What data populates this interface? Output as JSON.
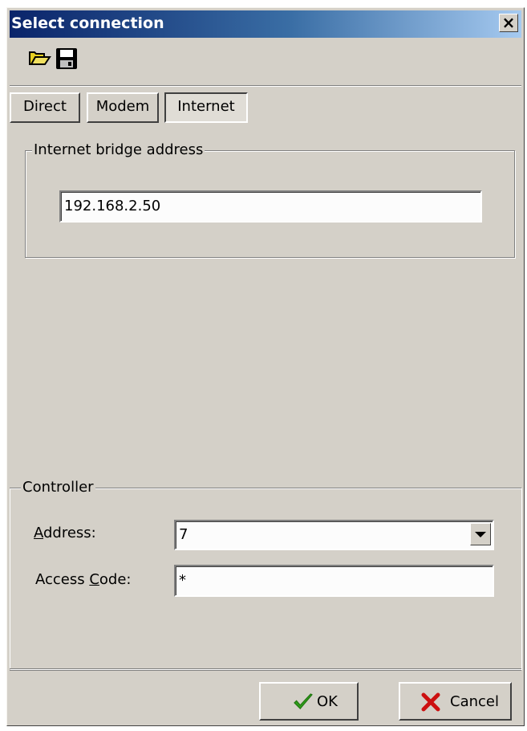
{
  "window": {
    "title": "Select connection",
    "close_glyph": "×"
  },
  "toolbar": {
    "open_icon": "open-folder-icon",
    "save_icon": "floppy-disk-icon"
  },
  "tabs": [
    {
      "label": "Direct"
    },
    {
      "label": "Modem"
    },
    {
      "label": "Internet"
    }
  ],
  "active_tab": "Internet",
  "internet": {
    "group_label": "Internet bridge address",
    "address_value": "192.168.2.50"
  },
  "controller": {
    "group_label": "Controller",
    "address_label_prefix": "A",
    "address_label_rest": "ddress:",
    "address_value": "7",
    "access_label_pre": "Access ",
    "access_label_ul": "C",
    "access_label_rest": "ode:",
    "access_value": "*"
  },
  "buttons": {
    "ok_label": "OK",
    "cancel_label": "Cancel"
  },
  "colors": {
    "dialog_bg": "#d4d0c8",
    "title_start": "#0a246a",
    "title_end": "#a6caf0",
    "ok_check": "#2e9a1a",
    "cancel_x": "#cc1010"
  }
}
